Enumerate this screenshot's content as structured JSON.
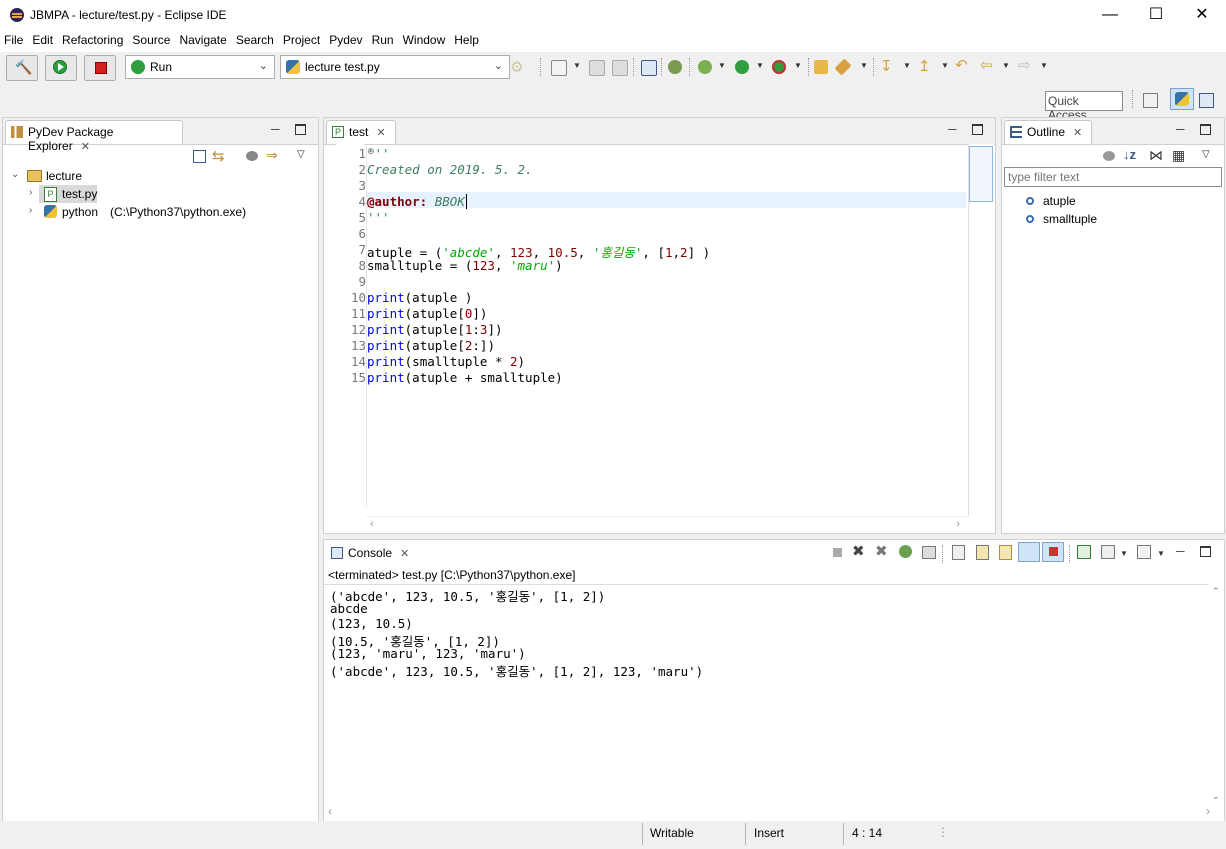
{
  "window": {
    "title": "JBMPA - lecture/test.py - Eclipse IDE"
  },
  "menu": [
    "File",
    "Edit",
    "Refactoring",
    "Source",
    "Navigate",
    "Search",
    "Project",
    "Pydev",
    "Run",
    "Window",
    "Help"
  ],
  "toolbar": {
    "run_config": "Run",
    "launch_target": "lecture test.py",
    "quick_access": "Quick Access"
  },
  "explorer": {
    "title": "PyDev Package Explorer",
    "project": "lecture",
    "file": "test.py",
    "interpreter": "python",
    "interpreter_path": "(C:\\Python37\\python.exe)"
  },
  "editor": {
    "tab": "test",
    "lines": [
      {
        "n": "1",
        "text": "'''"
      },
      {
        "n": "2",
        "text": "Created on 2019. 5. 2."
      },
      {
        "n": "3",
        "text": ""
      },
      {
        "n": "4",
        "text": "@author: BBOK"
      },
      {
        "n": "5",
        "text": "'''"
      },
      {
        "n": "6",
        "text": ""
      },
      {
        "n": "7",
        "text": "atuple = ('abcde', 123, 10.5, '홍길동', [1,2] )"
      },
      {
        "n": "8",
        "text": "smalltuple = (123, 'maru')"
      },
      {
        "n": "9",
        "text": ""
      },
      {
        "n": "10",
        "text": "print(atuple )"
      },
      {
        "n": "11",
        "text": "print(atuple[0])"
      },
      {
        "n": "12",
        "text": "print(atuple[1:3])"
      },
      {
        "n": "13",
        "text": "print(atuple[2:])"
      },
      {
        "n": "14",
        "text": "print(smalltuple * 2)"
      },
      {
        "n": "15",
        "text": "print(atuple + smalltuple)"
      }
    ]
  },
  "outline": {
    "title": "Outline",
    "filter_placeholder": "type filter text",
    "items": [
      "atuple",
      "smalltuple"
    ]
  },
  "console": {
    "title": "Console",
    "status": "<terminated> test.py [C:\\Python37\\python.exe]",
    "output": [
      "('abcde', 123, 10.5, '홍길동', [1, 2])",
      "abcde",
      "(123, 10.5)",
      "(10.5, '홍길동', [1, 2])",
      "(123, 'maru', 123, 'maru')",
      "('abcde', 123, 10.5, '홍길동', [1, 2], 123, 'maru')"
    ]
  },
  "status": {
    "mode": "Writable",
    "insert": "Insert",
    "position": "4 : 14"
  },
  "colors": {
    "accent": "#3875d7",
    "comment": "#3f7f5f",
    "string": "#00aa00",
    "keyword": "#0000ff"
  }
}
